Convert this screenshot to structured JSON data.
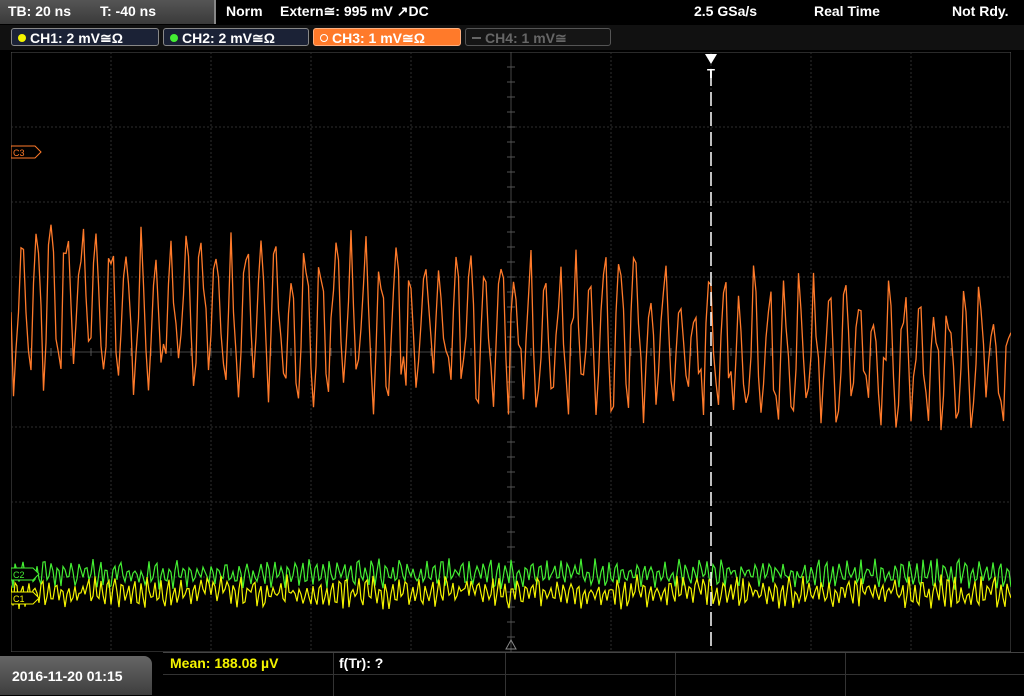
{
  "status_bar": {
    "timebase": "TB: 20 ns",
    "trigger_time": "T: -40 ns",
    "acq_mode": "Norm",
    "trigger_source": "Extern≅: 995 mV ↗DC",
    "sample_rate": "2.5 GSa/s",
    "acq_type": "Real Time",
    "trigger_status": "Not Rdy."
  },
  "channels": [
    {
      "label": "CH1: 2 mV≅Ω",
      "color": "#f4f400",
      "active": true
    },
    {
      "label": "CH2: 2 mV≅Ω",
      "color": "#44ee33",
      "active": true
    },
    {
      "label": "CH3: 1 mV≅Ω",
      "color": "#ff7a2a",
      "active": true,
      "selected": true
    },
    {
      "label": "CH4: 1 mV≅",
      "color": "#666666",
      "active": false
    }
  ],
  "markers": {
    "ch3_ref": "C3",
    "ch2_ref": "C2",
    "ch1_ref": "C1",
    "trigger": "T"
  },
  "measurements": {
    "mean": "Mean: 188.08 µV",
    "freq": "f(Tr): ?"
  },
  "datetime": "2016-11-20 01:15",
  "colors": {
    "ch1": "#f4f400",
    "ch2": "#44ee33",
    "ch3": "#ff7a2a",
    "grid": "#3c3c3c",
    "selected_tab": "#ff7a2a"
  }
}
